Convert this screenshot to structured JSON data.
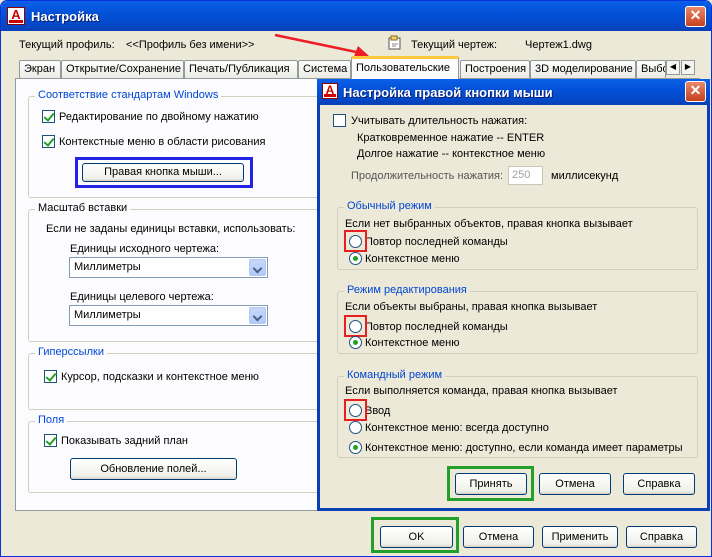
{
  "main_window": {
    "title": "Настройка",
    "profile_label": "Текущий профиль:",
    "profile_value": "<<Профиль без имени>>",
    "drawing_label": "Текущий чертеж:",
    "drawing_value": "Чертеж1.dwg",
    "close_symbol": "✕"
  },
  "tabs": [
    {
      "label": "Экран"
    },
    {
      "label": "Открытие/Сохранение"
    },
    {
      "label": "Печать/Публикация"
    },
    {
      "label": "Система"
    },
    {
      "label": "Пользовательские",
      "active": true
    },
    {
      "label": "Построения"
    },
    {
      "label": "3D моделирование"
    },
    {
      "label": "Выбо"
    }
  ],
  "tab_scroll": {
    "left": "◀",
    "right": "▶"
  },
  "windows_standards": {
    "legend": "Соответствие стандартам Windows",
    "double_click_edit": {
      "label": "Редактирование по двойному нажатию",
      "checked": true
    },
    "shortcut_menus": {
      "label": "Контекстные меню в области рисования",
      "checked": true
    },
    "right_click_button": "Правая кнопка мыши..."
  },
  "insert_scale": {
    "legend": "Масштаб вставки",
    "hint": "Если не заданы единицы вставки, использовать:",
    "source_label": "Единицы исходного чертежа:",
    "source_value": "Миллиметры",
    "target_label": "Единицы целевого чертежа:",
    "target_value": "Миллиметры"
  },
  "hyperlinks": {
    "legend": "Гиперссылки",
    "cursor_option": {
      "label": "Курсор, подсказки и контекстное меню",
      "checked": true
    }
  },
  "fields": {
    "legend": "Поля",
    "background": {
      "label": "Показывать задний план",
      "checked": true
    },
    "update_button": "Обновление полей..."
  },
  "bottom_buttons": {
    "ok": "OK",
    "cancel": "Отмена",
    "apply": "Применить",
    "help": "Справка"
  },
  "right_click_dialog": {
    "title": "Настройка правой кнопки мыши",
    "close_symbol": "✕",
    "duration_option": {
      "label": "Учитывать длительность нажатия:",
      "checked": false
    },
    "quick_click": "Кратковременное нажатие -- ENTER",
    "long_click": "Долгое нажатие -- контекстное меню",
    "duration_label": "Продолжительность нажатия:",
    "duration_value": "250",
    "duration_unit": "миллисекунд",
    "default_mode": {
      "legend": "Обычный режим",
      "hint": "Если нет выбранных объектов, правая кнопка вызывает",
      "options": [
        {
          "label": "Повтор последней команды",
          "checked": false
        },
        {
          "label": "Контекстное меню",
          "checked": true
        }
      ]
    },
    "edit_mode": {
      "legend": "Режим редактирования",
      "hint": "Если объекты выбраны, правая кнопка вызывает",
      "options": [
        {
          "label": "Повтор последней команды",
          "checked": false
        },
        {
          "label": "Контекстное меню",
          "checked": true
        }
      ]
    },
    "command_mode": {
      "legend": "Командный режим",
      "hint": "Если выполняется команда, правая кнопка вызывает",
      "options": [
        {
          "label": "Ввод",
          "checked": false
        },
        {
          "label": "Контекстное меню: всегда доступно",
          "checked": false
        },
        {
          "label": "Контекстное меню: доступно, если команда имеет параметры",
          "checked": true
        }
      ]
    },
    "buttons": {
      "apply": "Принять",
      "cancel": "Отмена",
      "help": "Справка"
    }
  },
  "colors": {
    "titlebar": "#0451d8",
    "legend_text": "#0046d5",
    "highlight_blue": "#2323e6",
    "highlight_red": "#e62020",
    "highlight_green": "#22a02a",
    "arrow": "#ee1c24"
  }
}
